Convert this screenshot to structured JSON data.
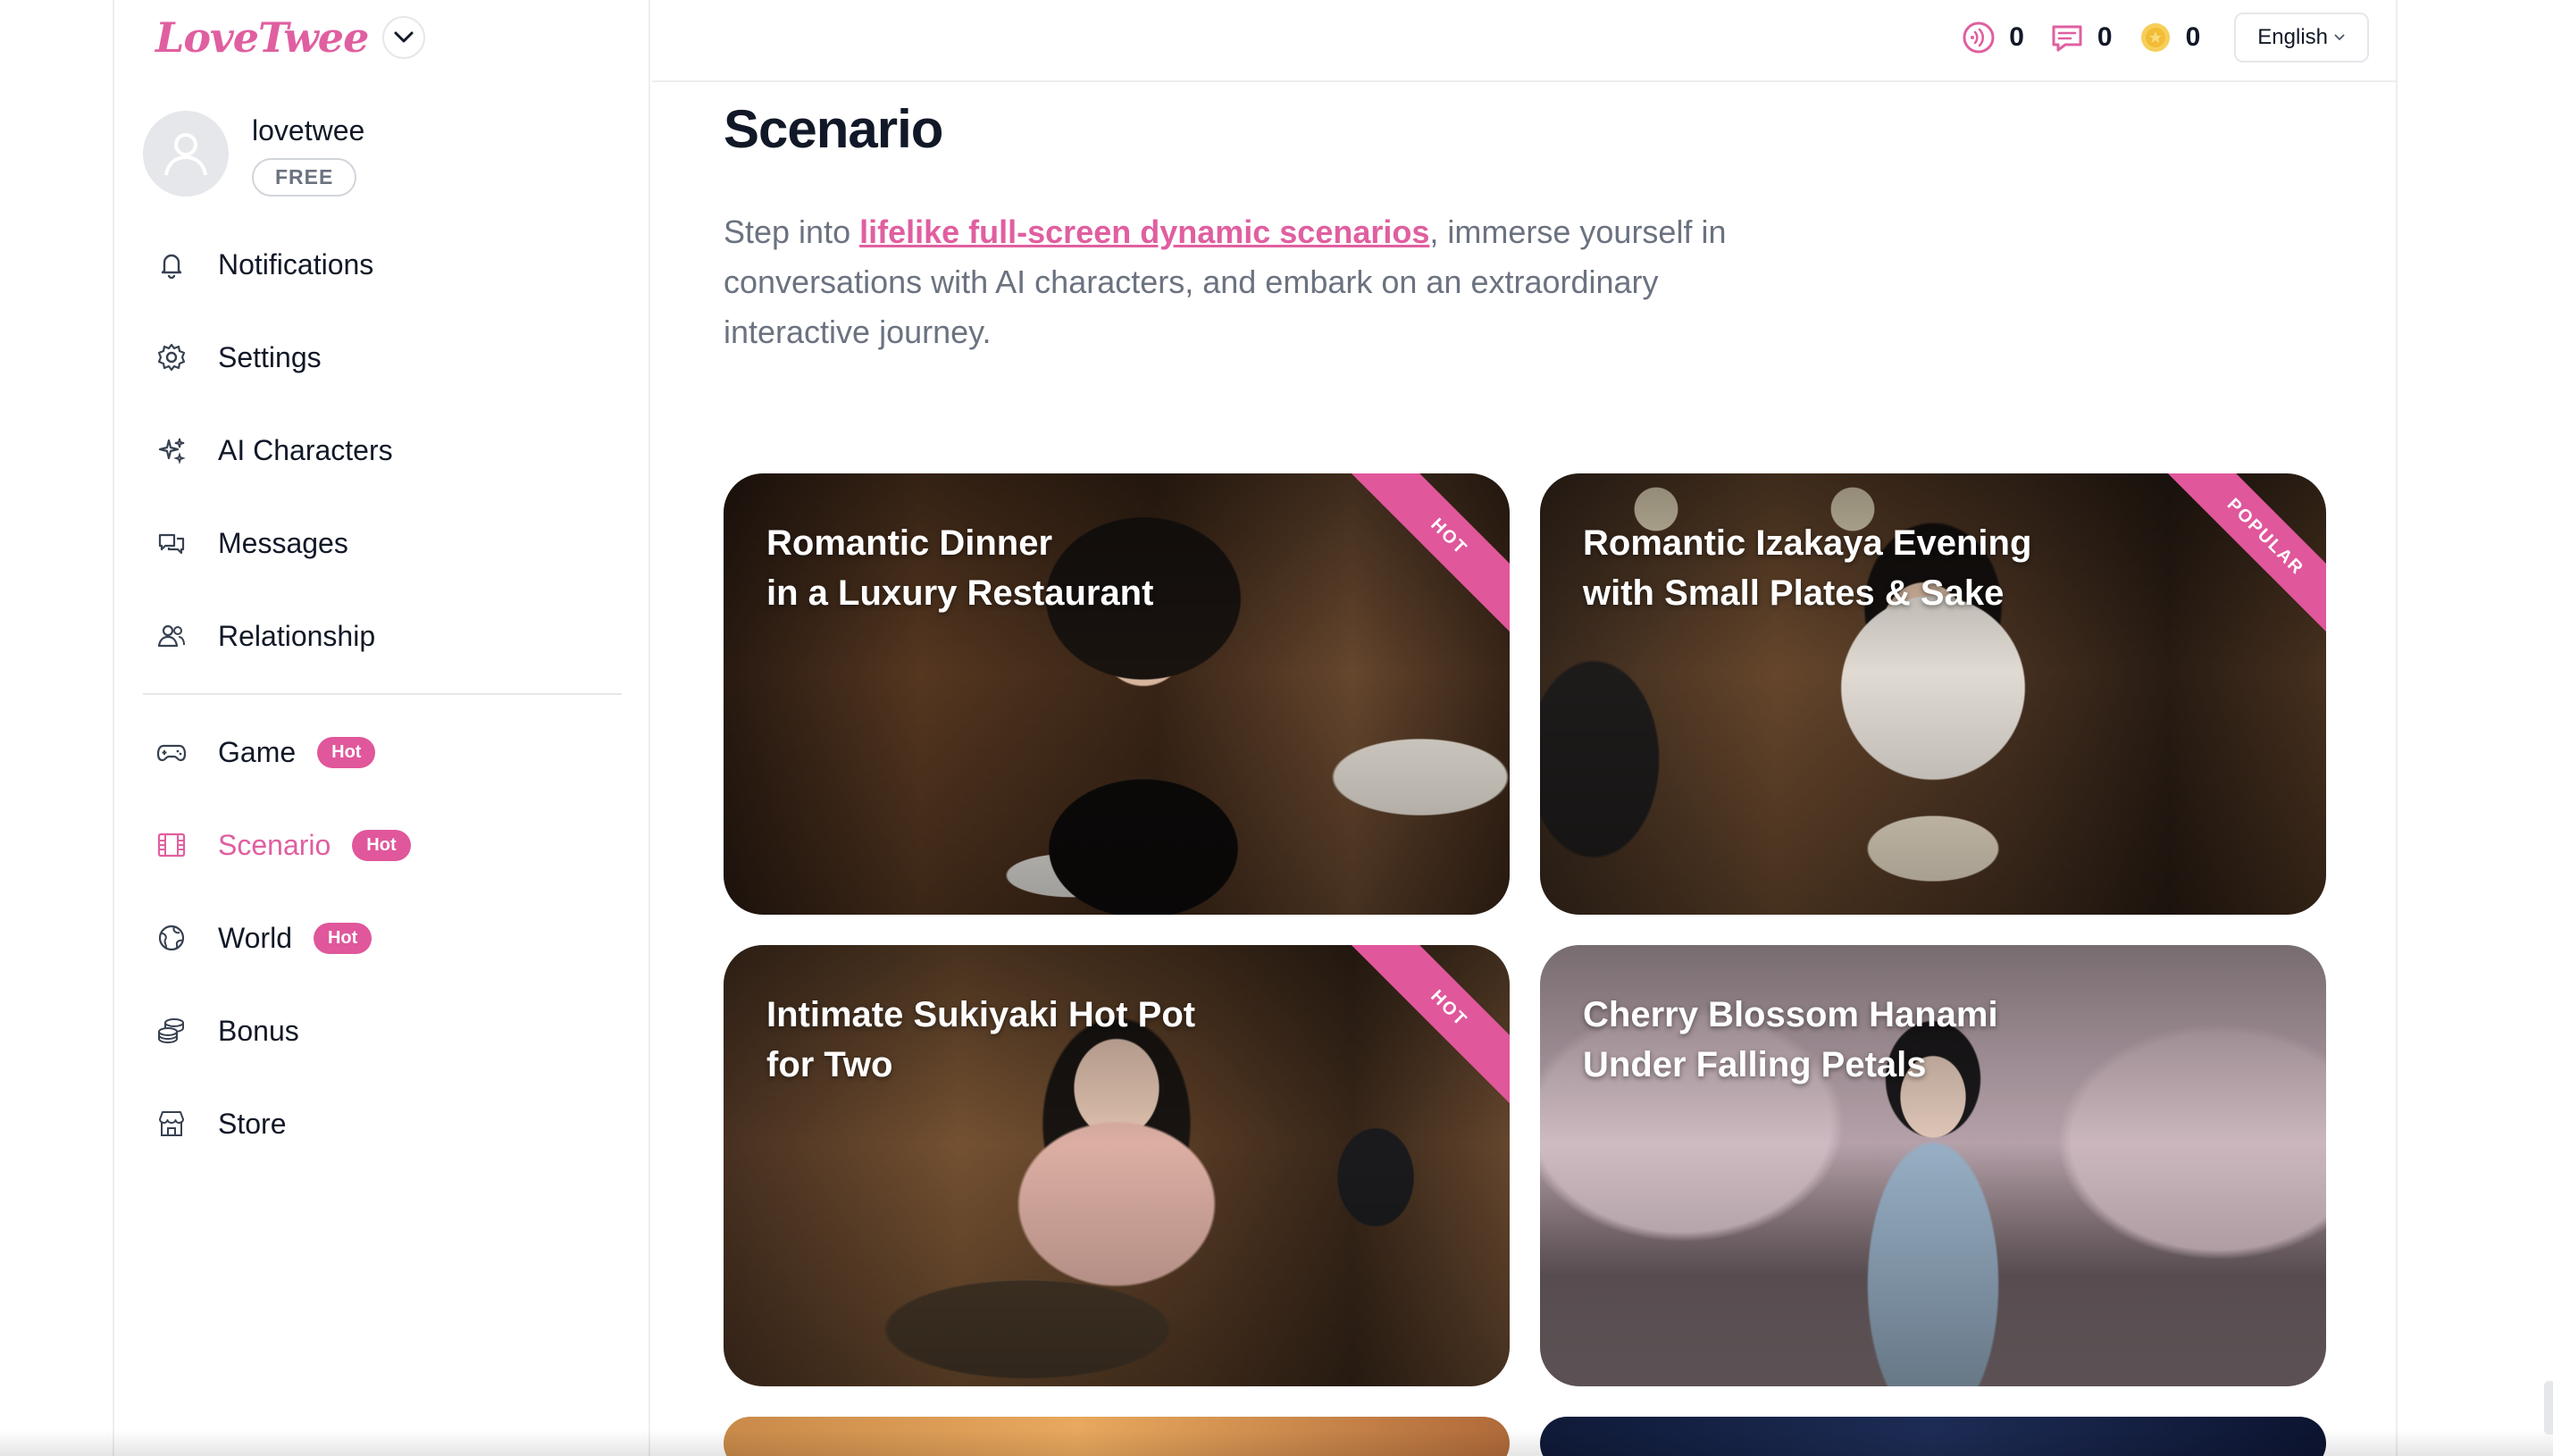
{
  "brand": {
    "logo_text": "LoveTwee",
    "accent": "#e05fa0",
    "badge_color": "#e0579b"
  },
  "profile": {
    "username": "lovetwee",
    "plan": "FREE"
  },
  "nav": {
    "primary": [
      {
        "label": "Notifications",
        "icon": "bell-icon"
      },
      {
        "label": "Settings",
        "icon": "gear-icon"
      },
      {
        "label": "AI Characters",
        "icon": "sparkles-icon"
      },
      {
        "label": "Messages",
        "icon": "chat-bubbles-icon"
      },
      {
        "label": "Relationship",
        "icon": "people-icon"
      }
    ],
    "secondary": [
      {
        "label": "Game",
        "icon": "gamepad-icon",
        "badge": "Hot",
        "active": false
      },
      {
        "label": "Scenario",
        "icon": "film-icon",
        "badge": "Hot",
        "active": true
      },
      {
        "label": "World",
        "icon": "globe-icon",
        "badge": "Hot",
        "active": false
      },
      {
        "label": "Bonus",
        "icon": "coins-stack-icon",
        "badge": "",
        "active": false
      },
      {
        "label": "Store",
        "icon": "storefront-icon",
        "badge": "",
        "active": false
      }
    ]
  },
  "topbar": {
    "stats": [
      {
        "icon": "voice-icon",
        "value": "0"
      },
      {
        "icon": "message-icon",
        "value": "0"
      },
      {
        "icon": "coin-icon",
        "value": "0"
      }
    ],
    "language": "English"
  },
  "main": {
    "title": "Scenario",
    "intro_prefix": "Step into ",
    "intro_link": "lifelike full-screen dynamic scenarios",
    "intro_suffix": ", immerse yourself in conversations with AI characters, and embark on an extraordinary interactive journey."
  },
  "cards": [
    {
      "title_line1": "Romantic Dinner",
      "title_line2": "in a Luxury Restaurant",
      "tag": "HOT"
    },
    {
      "title_line1": "Romantic Izakaya Evening",
      "title_line2": "with Small Plates & Sake",
      "tag": "POPULAR"
    },
    {
      "title_line1": "Intimate Sukiyaki Hot Pot",
      "title_line2": "for Two",
      "tag": "HOT"
    },
    {
      "title_line1": "Cherry Blossom Hanami",
      "title_line2": "Under Falling Petals",
      "tag": ""
    }
  ]
}
